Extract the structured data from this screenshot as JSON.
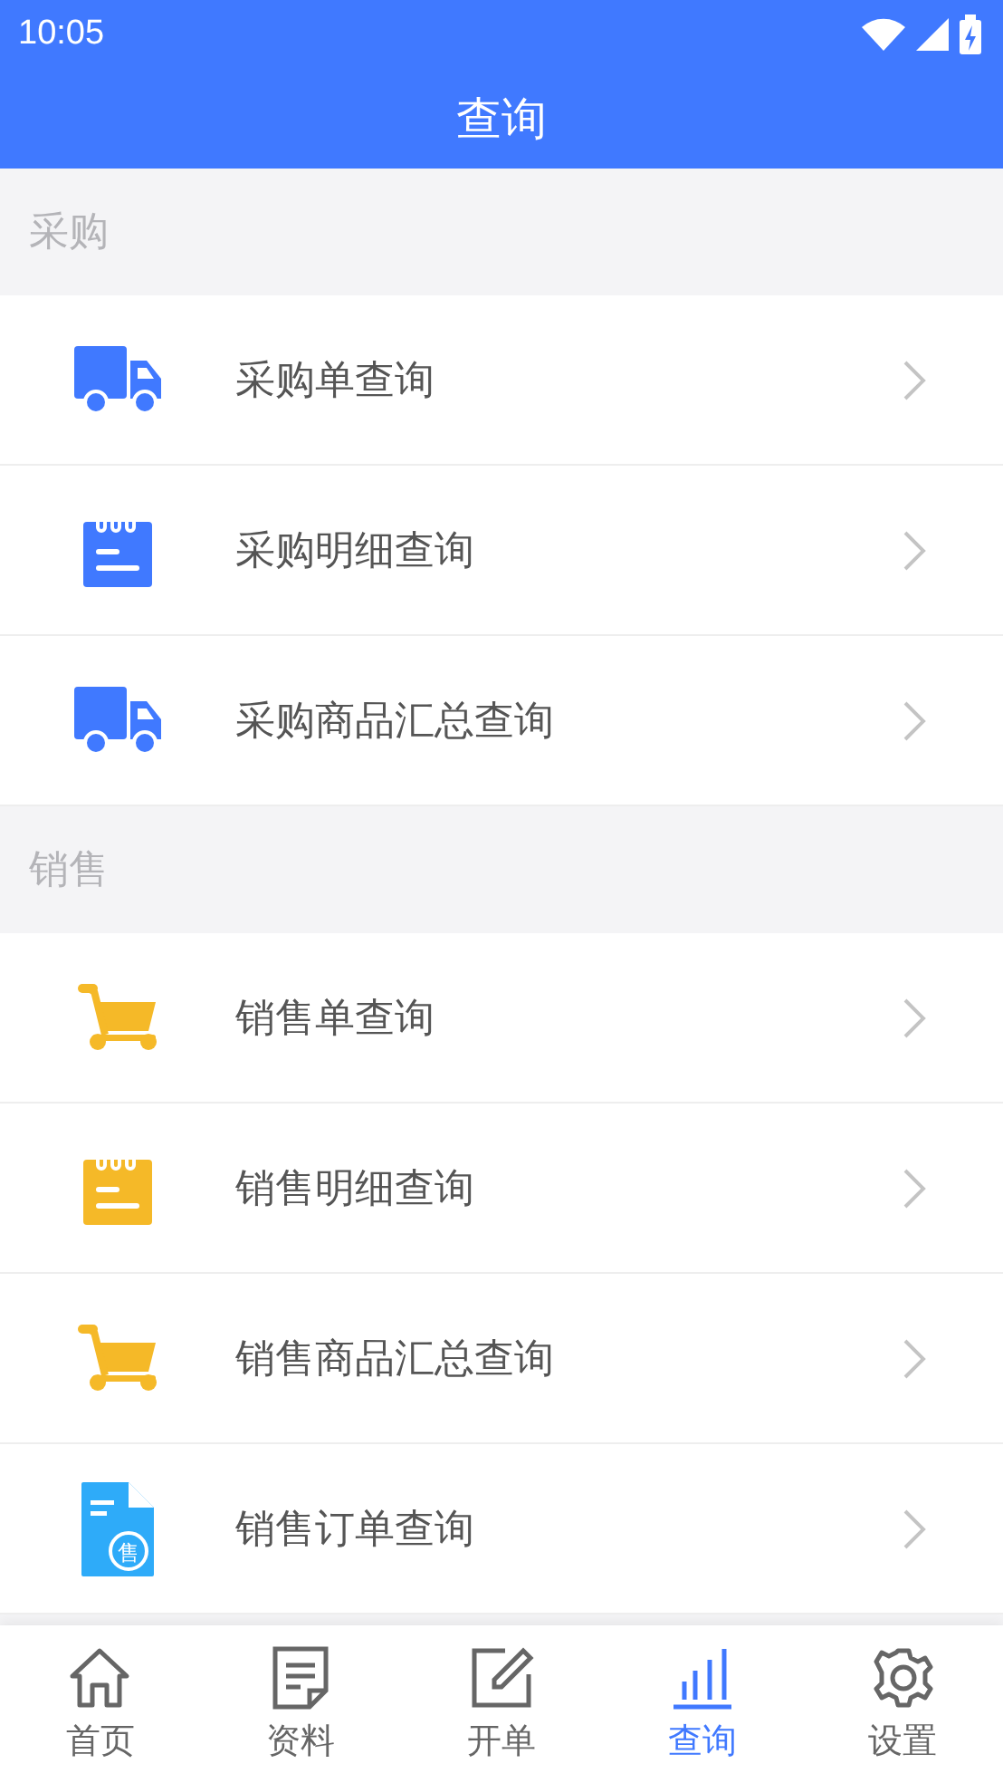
{
  "status_bar": {
    "time": "10:05"
  },
  "header": {
    "title": "查询"
  },
  "sections": [
    {
      "title": "采购",
      "items": [
        {
          "kind": "truck",
          "color": "#4079ff",
          "label": "采购单查询"
        },
        {
          "kind": "notepad",
          "color": "#4079ff",
          "label": "采购明细查询"
        },
        {
          "kind": "truck",
          "color": "#4079ff",
          "label": "采购商品汇总查询"
        }
      ]
    },
    {
      "title": "销售",
      "items": [
        {
          "kind": "cart",
          "color": "#f5b928",
          "label": "销售单查询"
        },
        {
          "kind": "notepad",
          "color": "#f5b928",
          "label": "销售明细查询"
        },
        {
          "kind": "cart",
          "color": "#f5b928",
          "label": "销售商品汇总查询"
        },
        {
          "kind": "document",
          "color": "#2eabf9",
          "label": "销售订单查询",
          "icon_text": "售"
        }
      ]
    }
  ],
  "tabs": [
    {
      "kind": "home",
      "label": "首页",
      "selected": false
    },
    {
      "kind": "doc",
      "label": "资料",
      "selected": false
    },
    {
      "kind": "edit",
      "label": "开单",
      "selected": false
    },
    {
      "kind": "chart",
      "label": "查询",
      "selected": true
    },
    {
      "kind": "gear",
      "label": "设置",
      "selected": false
    }
  ]
}
